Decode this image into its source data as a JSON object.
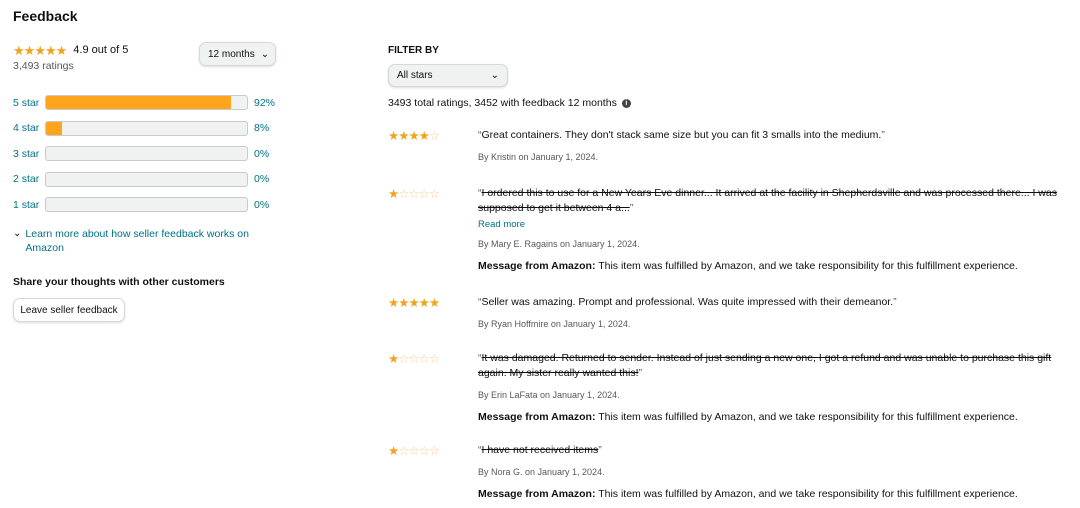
{
  "page": {
    "title": "Feedback"
  },
  "summary": {
    "stars": 5,
    "rating_text": "4.9 out of 5",
    "ratings_count": "3,493 ratings",
    "period_label": "12 months",
    "star_color": "#f0a31b"
  },
  "histogram": [
    {
      "label": "5 star",
      "percent": 92,
      "pct_text": "92%"
    },
    {
      "label": "4 star",
      "percent": 8,
      "pct_text": "8%"
    },
    {
      "label": "3 star",
      "percent": 0,
      "pct_text": "0%"
    },
    {
      "label": "2 star",
      "percent": 0,
      "pct_text": "0%"
    },
    {
      "label": "1 star",
      "percent": 0,
      "pct_text": "0%"
    }
  ],
  "learn_more": "Learn more about how seller feedback works on Amazon",
  "share": {
    "heading": "Share your thoughts with other customers",
    "button": "Leave seller feedback"
  },
  "filter": {
    "label": "FILTER BY",
    "selected": "All stars",
    "totals": "3493 total ratings, 3452 with feedback 12 months"
  },
  "reviews": [
    {
      "stars": 4,
      "text": "Great containers. They don't stack same size but you can fit 3 smalls into the medium.",
      "struck": false,
      "read_more": "",
      "by": "By Kristin on January 1, 2024.",
      "message_label": "",
      "message": ""
    },
    {
      "stars": 1,
      "text": "I ordered this to use for a New Years Eve dinner... It arrived at the facility in Shepherdsville and was processed there... I was supposed to get it between 4 a...",
      "struck": true,
      "read_more": "Read more",
      "by": "By Mary E. Ragains on January 1, 2024.",
      "message_label": "Message from Amazon:",
      "message": "This item was fulfilled by Amazon, and we take responsibility for this fulfillment experience."
    },
    {
      "stars": 5,
      "text": "Seller was amazing. Prompt and professional. Was quite impressed with their demeanor.",
      "struck": false,
      "read_more": "",
      "by": "By Ryan Hoffmire on January 1, 2024.",
      "message_label": "",
      "message": ""
    },
    {
      "stars": 1,
      "text": "It was damaged. Returned to sender. Instead of just sending a new one, I got a refund and was unable to purchase this gift again. My sister really wanted this!",
      "struck": true,
      "read_more": "",
      "by": "By Erin LaFata on January 1, 2024.",
      "message_label": "Message from Amazon:",
      "message": "This item was fulfilled by Amazon, and we take responsibility for this fulfillment experience."
    },
    {
      "stars": 1,
      "text": "I have not received items",
      "struck": true,
      "read_more": "",
      "by": "By Nora G. on January 1, 2024.",
      "message_label": "Message from Amazon:",
      "message": "This item was fulfilled by Amazon, and we take responsibility for this fulfillment experience."
    }
  ]
}
